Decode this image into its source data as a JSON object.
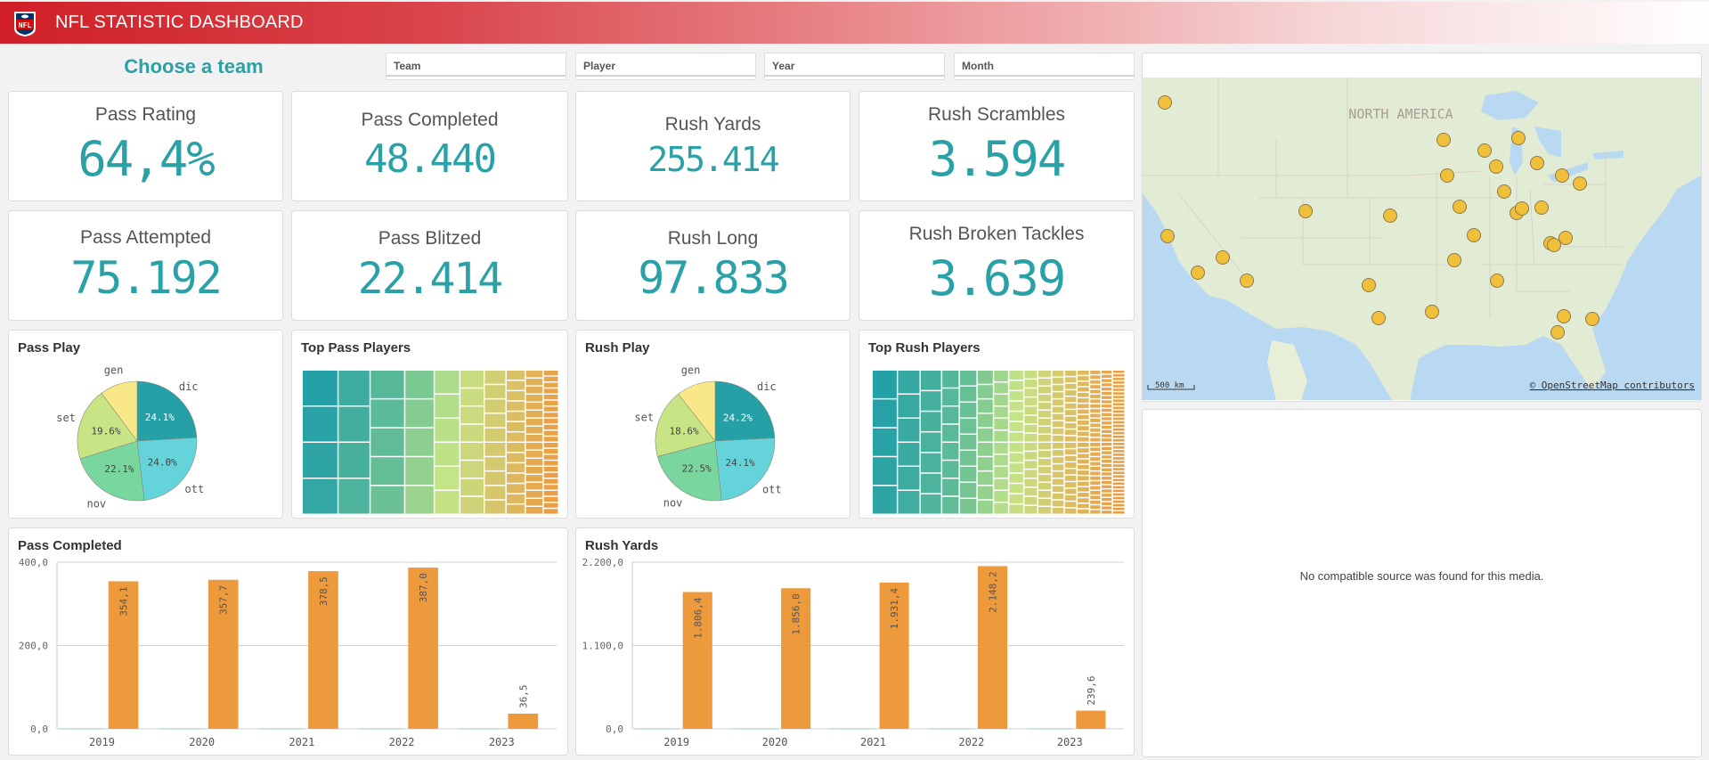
{
  "header": {
    "title": "NFL STATISTIC DASHBOARD",
    "logo": "nfl-shield-logo",
    "gradient_start": "#d01f26",
    "gradient_end": "#ffffff"
  },
  "choose_label": "Choose a team",
  "filters": [
    {
      "label": "Team"
    },
    {
      "label": "Player"
    },
    {
      "label": "Year"
    },
    {
      "label": "Month"
    }
  ],
  "kpis": [
    {
      "label": "Pass Rating",
      "value": "64,4%"
    },
    {
      "label": "Pass Completed",
      "value": "48.440"
    },
    {
      "label": "Rush Yards",
      "value": "255.414"
    },
    {
      "label": "Rush Scrambles",
      "value": "3.594"
    },
    {
      "label": "Pass Attempted",
      "value": "75.192"
    },
    {
      "label": "Pass Blitzed",
      "value": "22.414"
    },
    {
      "label": "Rush Long",
      "value": "97.833"
    },
    {
      "label": "Rush Broken Tackles",
      "value": "3.639"
    }
  ],
  "accent_color": "#2aa1a6",
  "bar_color": "#ed9a3c",
  "treemaps": [
    {
      "title": "Top Pass Players"
    },
    {
      "title": "Top Rush Players"
    }
  ],
  "map": {
    "region_label": "NORTH AMERICA",
    "scale_label": "500 km",
    "attribution": "© OpenStreetMap contributors",
    "marker_color": "#f0c03a",
    "marker_count": 32
  },
  "media": {
    "message": "No compatible source was found for this media."
  },
  "chart_data": [
    {
      "type": "pie",
      "title": "Pass Play",
      "categories": [
        "dic",
        "ott",
        "nov",
        "set",
        "gen"
      ],
      "values": [
        24.1,
        24.0,
        22.1,
        19.6,
        10.2
      ],
      "labels": [
        "24.1%",
        "24.0%",
        "22.1%",
        "19.6%",
        ""
      ],
      "colors": [
        "#26a0a7",
        "#65d3da",
        "#79d69f",
        "#c8e585",
        "#f8e888"
      ]
    },
    {
      "type": "pie",
      "title": "Rush Play",
      "categories": [
        "dic",
        "ott",
        "nov",
        "set",
        "gen"
      ],
      "values": [
        24.2,
        24.1,
        22.5,
        18.6,
        10.6
      ],
      "labels": [
        "24.2%",
        "24.1%",
        "22.5%",
        "18.6%",
        ""
      ],
      "colors": [
        "#26a0a7",
        "#65d3da",
        "#79d69f",
        "#c8e585",
        "#f8e888"
      ]
    },
    {
      "type": "bar",
      "title": "Pass Completed",
      "categories": [
        "2019",
        "2020",
        "2021",
        "2022",
        "2023"
      ],
      "values": [
        354.1,
        357.7,
        378.5,
        387.0,
        36.5
      ],
      "value_labels": [
        "354,1",
        "357,7",
        "378,5",
        "387,0",
        "36,5"
      ],
      "yticks": [
        "0,0",
        "200,0",
        "400,0"
      ],
      "ylim": [
        0,
        400
      ],
      "xlabel": "",
      "ylabel": ""
    },
    {
      "type": "bar",
      "title": "Rush Yards",
      "categories": [
        "2019",
        "2020",
        "2021",
        "2022",
        "2023"
      ],
      "values": [
        1806.4,
        1856.0,
        1931.4,
        2148.2,
        239.6
      ],
      "value_labels": [
        "1.806,4",
        "1.856,0",
        "1.931,4",
        "2.148,2",
        "239,6"
      ],
      "yticks": [
        "0,0",
        "1.100,0",
        "2.200,0"
      ],
      "ylim": [
        0,
        2200
      ],
      "xlabel": "",
      "ylabel": ""
    }
  ]
}
